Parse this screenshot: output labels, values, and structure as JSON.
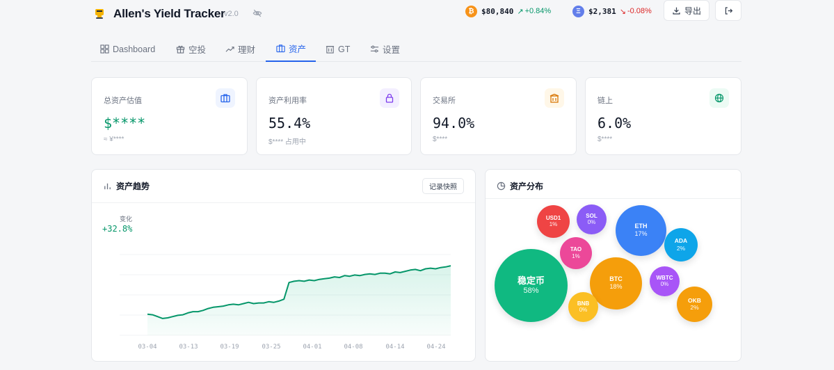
{
  "header": {
    "app_title": "Allen's Yield Tracker",
    "version": "v2.0",
    "tickers": [
      {
        "symbol_glyph": "₿",
        "color": "#f7931a",
        "price": "$80,840",
        "change": "+0.84%",
        "direction": "up"
      },
      {
        "symbol_glyph": "Ξ",
        "color": "#627eea",
        "price": "$2,381",
        "change": "-0.08%",
        "direction": "down"
      }
    ],
    "export_label": "导出"
  },
  "tabs": [
    {
      "label": "Dashboard",
      "icon": "grid-icon",
      "active": false
    },
    {
      "label": "空投",
      "icon": "gift-icon",
      "active": false
    },
    {
      "label": "理财",
      "icon": "trend-icon",
      "active": false
    },
    {
      "label": "资产",
      "icon": "briefcase-icon",
      "active": true
    },
    {
      "label": "GT",
      "icon": "building-icon",
      "active": false
    },
    {
      "label": "设置",
      "icon": "sliders-icon",
      "active": false
    }
  ],
  "stats": [
    {
      "label": "总资产估值",
      "value": "$****",
      "sub": "≈ ¥****",
      "icon": "briefcase-icon",
      "accent": "#2563eb",
      "icon_bg": "#eff4ff"
    },
    {
      "label": "资产利用率",
      "value": "55.4%",
      "sub": "$**** 占用中",
      "icon": "lock-icon",
      "accent": "#7c3aed",
      "icon_bg": "#f3efff"
    },
    {
      "label": "交易所",
      "value": "94.0%",
      "sub": "$****",
      "icon": "exchange-icon",
      "accent": "#d97706",
      "icon_bg": "#fff7e8"
    },
    {
      "label": "链上",
      "value": "6.0%",
      "sub": "$****",
      "icon": "globe-icon",
      "accent": "#059669",
      "icon_bg": "#ecfbf4"
    }
  ],
  "trend": {
    "title": "资产趋势",
    "snapshot_label": "记录快照",
    "change_label": "变化",
    "change_value": "+32.8%"
  },
  "chart_data": {
    "type": "area",
    "x_ticks": [
      "03-04",
      "03-13",
      "03-19",
      "03-25",
      "04-01",
      "04-08",
      "04-14",
      "04-24"
    ],
    "series": [
      {
        "values": [
          0.34,
          0.33,
          0.3,
          0.27,
          0.28,
          0.3,
          0.32,
          0.33,
          0.36,
          0.38,
          0.38,
          0.4,
          0.43,
          0.45,
          0.46,
          0.47,
          0.49,
          0.5,
          0.49,
          0.51,
          0.53,
          0.51,
          0.52,
          0.52,
          0.54,
          0.53,
          0.55,
          0.58,
          0.85,
          0.87,
          0.88,
          0.87,
          0.89,
          0.88,
          0.9,
          0.91,
          0.92,
          0.94,
          0.93,
          0.96,
          0.95,
          0.97,
          0.96,
          0.98,
          0.99,
          0.98,
          1.0,
          1.0,
          0.99,
          1.02,
          1.01,
          1.03,
          1.05,
          1.06,
          1.04,
          1.07,
          1.08,
          1.07,
          1.09,
          1.1,
          1.12
        ]
      }
    ],
    "line_color": "#059669",
    "grid": true
  },
  "distribution": {
    "title": "资产分布",
    "items": [
      {
        "name": "USD1",
        "pct": "1%",
        "color": "#ef4444"
      },
      {
        "name": "SOL",
        "pct": "0%",
        "color": "#8b5cf6"
      },
      {
        "name": "ETH",
        "pct": "17%",
        "color": "#3b82f6"
      },
      {
        "name": "ADA",
        "pct": "2%",
        "color": "#0ea5e9"
      },
      {
        "name": "TAO",
        "pct": "1%",
        "color": "#ec4899"
      },
      {
        "name": "稳定币",
        "pct": "58%",
        "color": "#10b981"
      },
      {
        "name": "BTC",
        "pct": "18%",
        "color": "#f59e0b"
      },
      {
        "name": "WBTC",
        "pct": "0%",
        "color": "#a855f7"
      },
      {
        "name": "BNB",
        "pct": "0%",
        "color": "#fbbf24"
      },
      {
        "name": "OKB",
        "pct": "2%",
        "color": "#f59e0b"
      }
    ]
  }
}
